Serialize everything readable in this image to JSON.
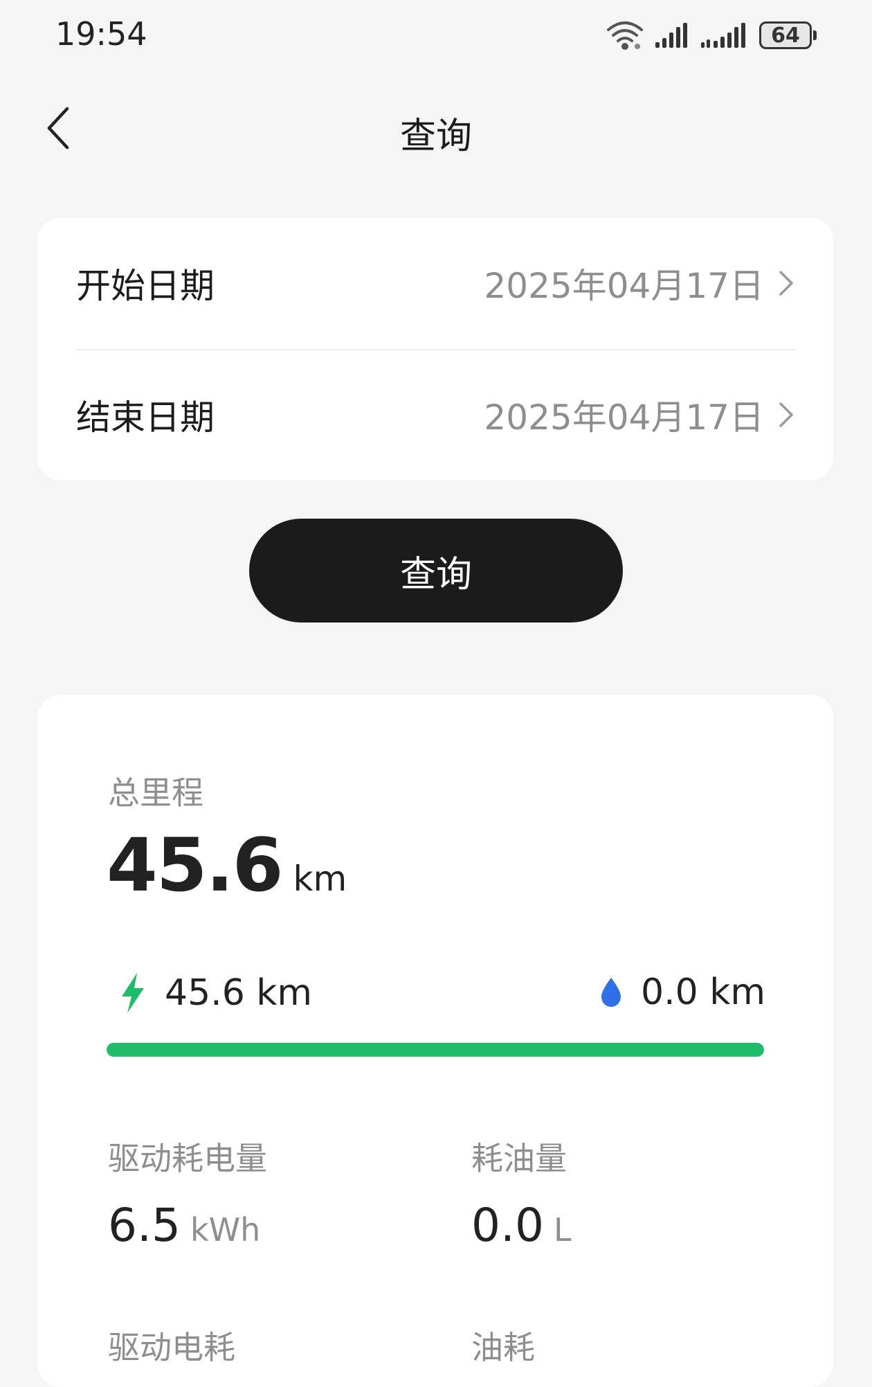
{
  "status_bar": {
    "time": "19:54",
    "battery": "64"
  },
  "nav": {
    "title": "查询"
  },
  "date_filter": {
    "start_label": "开始日期",
    "start_value": "2025年04月17日",
    "end_label": "结束日期",
    "end_value": "2025年04月17日"
  },
  "query_button": {
    "label": "查询"
  },
  "stats": {
    "total_mileage_label": "总里程",
    "total_mileage_value": "45.6",
    "total_mileage_unit": "km",
    "electric_mileage": "45.6 km",
    "fuel_mileage": "0.0 km",
    "electric_share_percent": 100,
    "electric_color": "#1fbc6a",
    "fuel_color": "#2f6fe8",
    "drive_energy_label": "驱动耗电量",
    "drive_energy_value": "6.5",
    "drive_energy_unit": "kWh",
    "fuel_used_label": "耗油量",
    "fuel_used_value": "0.0",
    "fuel_used_unit": "L",
    "drive_consumption_label": "驱动电耗",
    "fuel_consumption_label": "油耗"
  },
  "icons": {
    "back": "chevron-left-icon",
    "chevron": "chevron-right-icon",
    "electric": "lightning-icon",
    "fuel": "drop-icon",
    "wifi": "wifi-icon",
    "signal": "signal-icon"
  }
}
